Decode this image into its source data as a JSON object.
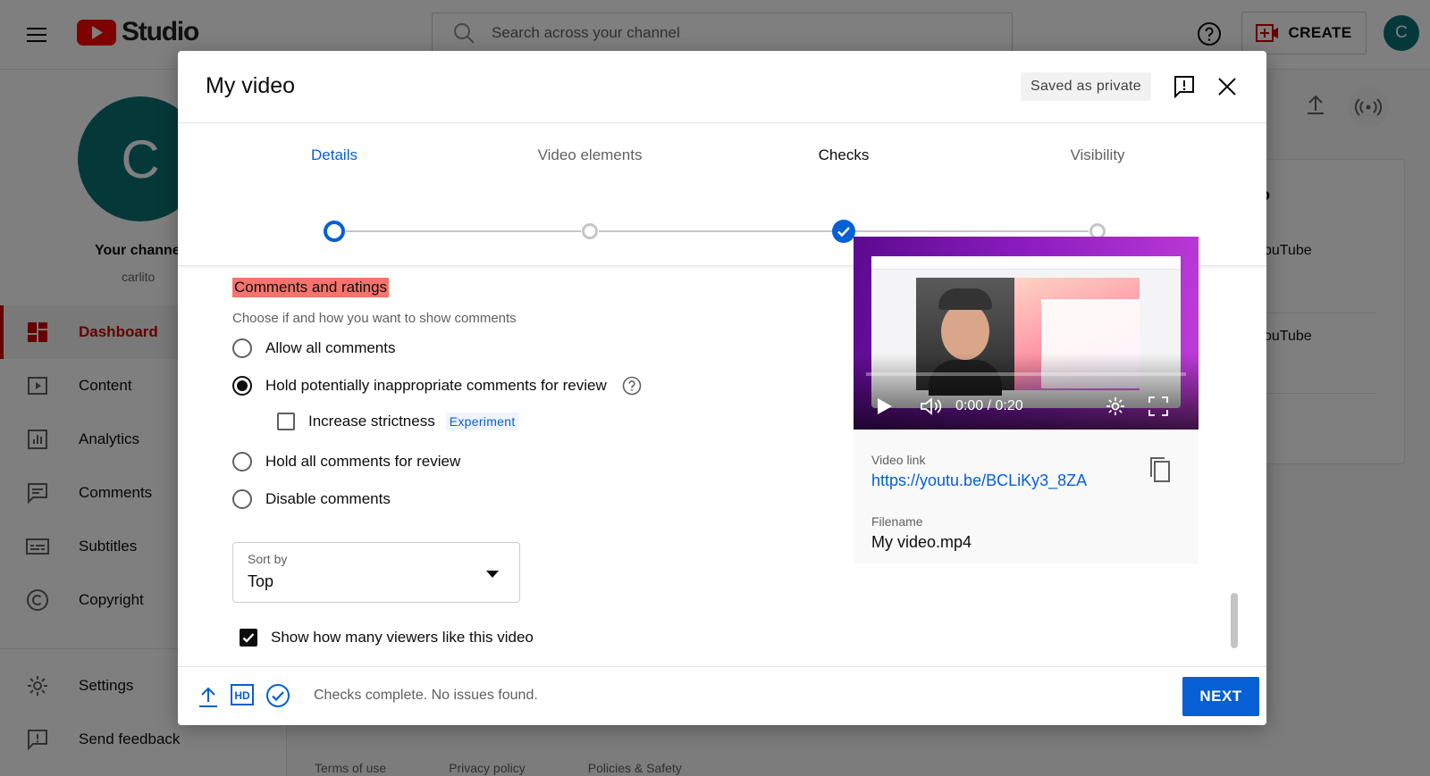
{
  "app": {
    "logo_text": "Studio",
    "search_placeholder": "Search across your channel",
    "create_label": "CREATE",
    "avatar_letter": "C"
  },
  "channel": {
    "avatar_letter": "C",
    "title": "Your channel",
    "handle": "carlito"
  },
  "sidebar": {
    "items": [
      {
        "label": "Dashboard",
        "icon": "dashboard-icon",
        "active": true
      },
      {
        "label": "Content",
        "icon": "content-icon"
      },
      {
        "label": "Analytics",
        "icon": "analytics-icon"
      },
      {
        "label": "Comments",
        "icon": "comments-icon"
      },
      {
        "label": "Subtitles",
        "icon": "subtitles-icon"
      },
      {
        "label": "Copyright",
        "icon": "copyright-icon"
      }
    ],
    "bottom_items": [
      {
        "label": "Settings",
        "icon": "gear-icon"
      },
      {
        "label": "Send feedback",
        "icon": "feedback-icon"
      }
    ]
  },
  "background": {
    "card_line1": "ouTube",
    "card_line2": "ouTube",
    "card_heading": "o",
    "footer_links": [
      "Terms of use",
      "Privacy policy",
      "Policies & Safety"
    ]
  },
  "dialog": {
    "title": "My video",
    "saved_badge": "Saved as private",
    "steps": [
      {
        "label": "Details",
        "state": "current"
      },
      {
        "label": "Video elements",
        "state": "todo"
      },
      {
        "label": "Checks",
        "state": "done"
      },
      {
        "label": "Visibility",
        "state": "todo"
      }
    ],
    "comments": {
      "title": "Comments and ratings",
      "description": "Choose if and how you want to show comments",
      "options": [
        {
          "label": "Allow all comments",
          "checked": false
        },
        {
          "label": "Hold potentially inappropriate comments for review",
          "checked": true
        },
        {
          "label": "Hold all comments for review",
          "checked": false
        },
        {
          "label": "Disable comments",
          "checked": false
        }
      ],
      "strictness_label": "Increase strictness",
      "strictness_checked": false,
      "experiment_badge": "Experiment",
      "sort_by_label": "Sort by",
      "sort_by_value": "Top",
      "show_likes_label": "Show how many viewers like this video",
      "show_likes_checked": true
    },
    "preview": {
      "time": "0:00 / 0:20",
      "video_link_label": "Video link",
      "video_link": "https://youtu.be/BCLiKy3_8ZA",
      "filename_label": "Filename",
      "filename": "My video.mp4"
    },
    "footer": {
      "status": "Checks complete. No issues found.",
      "next_label": "NEXT"
    }
  },
  "colors": {
    "accent_blue": "#065fd4",
    "brand_red": "#ff0000",
    "highlight": "#f7736d",
    "avatar_teal": "#0b7373"
  }
}
